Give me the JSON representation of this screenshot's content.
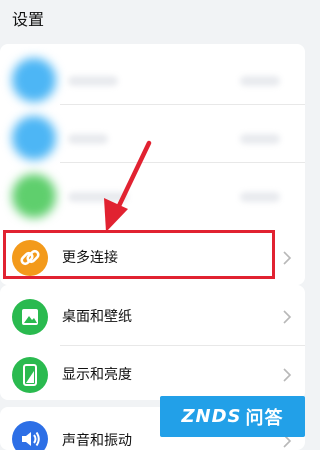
{
  "header": {
    "title": "设置"
  },
  "colors": {
    "accent_red": "#e12231",
    "more_connections_icon": "#f39a1b",
    "desktop_icon": "#2aba4f",
    "display_icon": "#2aba4f",
    "sound_icon": "#2d6fe6"
  },
  "menu": {
    "items": [
      {
        "label": "更多连接",
        "icon": "link-icon"
      },
      {
        "label": "桌面和壁纸",
        "icon": "picture-icon"
      },
      {
        "label": "显示和亮度",
        "icon": "phone-brightness-icon"
      },
      {
        "label": "声音和振动",
        "icon": "speaker-icon"
      }
    ]
  },
  "watermark": {
    "brand": "ZNDS",
    "suffix": "问答"
  }
}
